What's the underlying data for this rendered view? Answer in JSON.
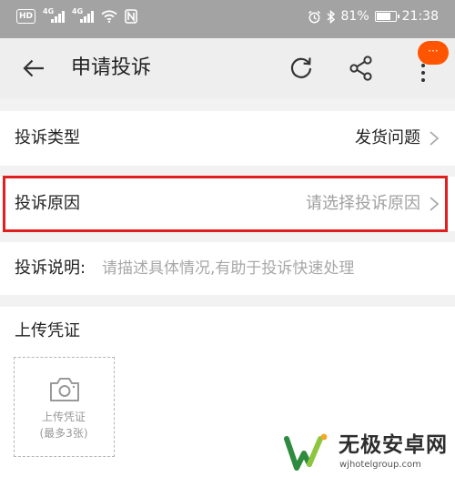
{
  "status_bar": {
    "hd": "HD",
    "sim1": "4G",
    "sim2": "4G",
    "battery_text": "81%",
    "battery_level": 0.81,
    "time": "21:38",
    "icons": [
      "hd-icon",
      "signal-icon",
      "signal-icon",
      "wifi-icon",
      "nfc-icon",
      "alarm-icon",
      "bluetooth-icon",
      "battery-icon"
    ]
  },
  "header": {
    "title": "申请投诉",
    "badge": "···",
    "badge_color": "#ff5500",
    "icons": [
      "back-arrow-icon",
      "refresh-icon",
      "share-icon",
      "more-icon"
    ]
  },
  "form": {
    "type": {
      "label": "投诉类型",
      "value": "发货问题"
    },
    "reason": {
      "label": "投诉原因",
      "placeholder": "请选择投诉原因"
    },
    "description": {
      "label": "投诉说明:",
      "placeholder": "请描述具体情况,有助于投诉快速处理"
    },
    "upload": {
      "title": "上传凭证",
      "box_label": "上传凭证",
      "box_limit": "(最多3张)"
    }
  },
  "highlight_color": "#e02020",
  "watermark": {
    "name": "无极安卓网",
    "url": "wjhotelgroup.com"
  }
}
